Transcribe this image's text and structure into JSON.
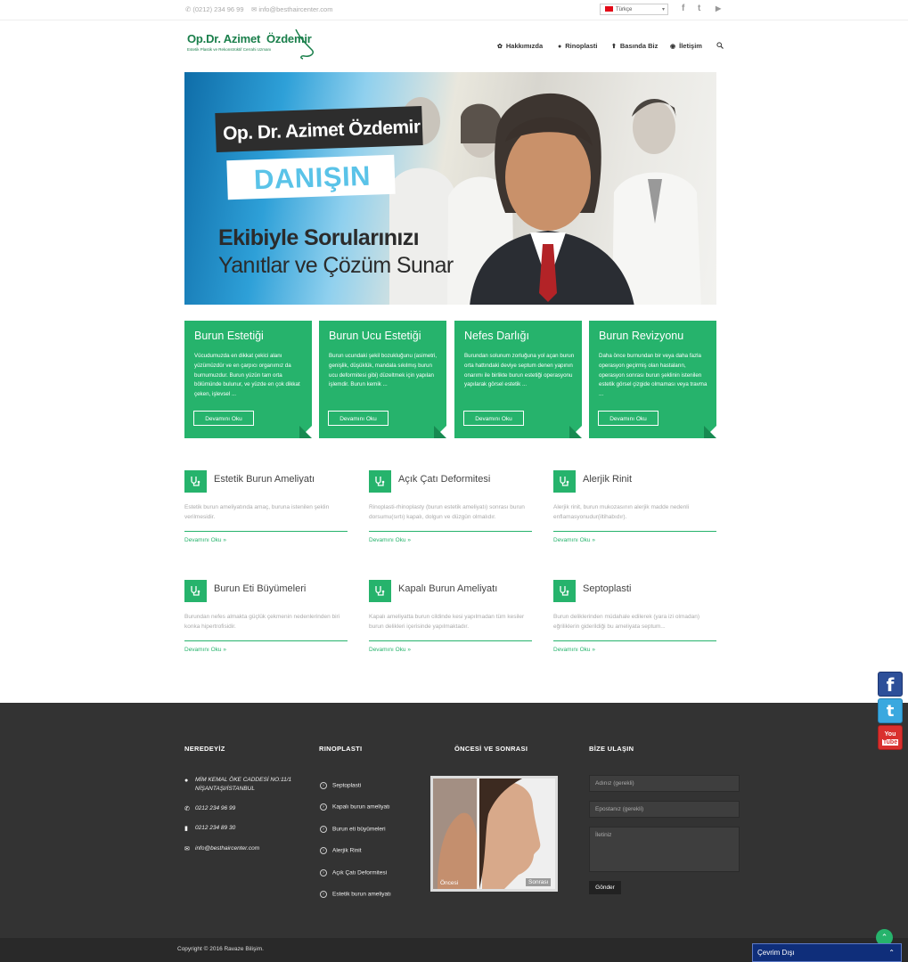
{
  "topbar": {
    "phone": "(0212) 234 96 99",
    "email": "info@besthaircenter.com",
    "language": "Türkçe",
    "social_icons": [
      "facebook-icon",
      "twitter-icon",
      "youtube-icon"
    ]
  },
  "logo": {
    "name_part1": "Op.Dr. Azimet",
    "name_part2": "Özdemir",
    "subtitle": "Estetik Plastik ve Rekonstrüktif Cerrahi Uzmanı"
  },
  "nav": {
    "items": [
      {
        "label": "Hakkımızda",
        "icon": "leaf-icon"
      },
      {
        "label": "Rinoplasti",
        "icon": "user-icon"
      },
      {
        "label": "Basında Biz",
        "icon": "pin-icon"
      },
      {
        "label": "İletişim",
        "icon": "wifi-icon"
      }
    ],
    "search_icon": "search-icon"
  },
  "hero": {
    "title": "Op. Dr. Azimet Özdemir",
    "highlight": "DANIŞIN",
    "line1": "Ekibiyle Sorularınızı",
    "line2": "Yanıtlar ve Çözüm Sunar"
  },
  "cards": [
    {
      "title": "Burun Estetiği",
      "text": "Vücudumuzda en dikkat çekici alanı yüzümüzdür ve en çarpıcı organımız da burnumuzdur.  Burun yüzün tam orta bölümünde bulunur, ve yüzde en çok dikkat çeken, işlevsel ...",
      "button": "Devamını Oku"
    },
    {
      "title": "Burun Ucu Estetiği",
      "text": "Burun ucundaki şekil bozukluğunu (asimetri, genişlik, düşüklük, mandala sıkılmış burun ucu deformitesi gibi) düzeltmek için yapılan işlemdir. Burun kemik ...",
      "button": "Devamını Oku"
    },
    {
      "title": "Nefes Darlığı",
      "text": "Burundan solunum zorluğuna yol açan burun orta hattındaki deviye septum denen yapının onarımı ile birlikte burun estetiği operasyonu yapılarak görsel estetik  ...",
      "button": "Devamını Oku"
    },
    {
      "title": "Burun Revizyonu",
      "text": "Daha önce burnundan bir veya daha fazla operasyon geçirmiş olan hastaların, operasyon sonrası burun şeklinin istenilen estetik görsel çizgide olmaması veya travma  ...",
      "button": "Devamını Oku"
    }
  ],
  "services": [
    {
      "title": "Estetik Burun Ameliyatı",
      "desc": "Estetik burun ameliyatında amaç, buruna istenilen şeklin verilmesidir.",
      "more": "Devamını Oku »"
    },
    {
      "title": "Açık Çatı Deformitesi",
      "desc": "Rinoplasti-rhinoplasty  (burun estetik ameliyatı) sonrası burun dorsumu(sırtı) kapalı, dolgun ve düzgün olmalıdır.",
      "more": "Devamını Oku »"
    },
    {
      "title": "Alerjik Rinit",
      "desc": "Alerjik rinit, burun mukozasının alerjik madde nedenli enflamasyonudur(iltihabıdır).",
      "more": "Devamını Oku »"
    },
    {
      "title": "Burun Eti Büyümeleri",
      "desc": "Burundan nefes almakta güçlük çekmenin nedenlerinden biri konka hipertrofisidir.",
      "more": "Devamını Oku »"
    },
    {
      "title": "Kapalı Burun Ameliyatı",
      "desc": "Kapalı ameliyatta burun cildinde kesi yapılmadan tüm kesiler burun delikleri içerisinde yapılmaktadır.",
      "more": "Devamını Oku »"
    },
    {
      "title": "Septoplasti",
      "desc": "Burun deliklerinden müdahale edilerek (yara izi olmadan) eğriliklerin giderildiği bu ameliyata septum...",
      "more": "Devamını Oku »"
    }
  ],
  "footer": {
    "col1_title": "NEREDEYİZ",
    "address_line1": "MİM KEMAL ÖKE CADDESİ NO:11/1",
    "address_line2": "NİŞANTAŞI/İSTANBUL",
    "phone": "0212 234 96 99",
    "fax": "0212 234 89 30",
    "email": "info@besthaircenter.com",
    "col2_title": "RINOPLASTI",
    "links": [
      "Septoplasti",
      "Kapalı burun ameliyatı",
      "Burun eti büyümeleri",
      "Alerjik Rinit",
      "Açık Çatı Deformitesi",
      "Estetik burun ameliyatı"
    ],
    "col3_title": "ÖNCESİ VE SONRASI",
    "before_label": "Öncesi",
    "after_label": "Sonrası",
    "col4_title": "BİZE ULAŞIN",
    "name_placeholder": "Adınız (gerekli)",
    "email_placeholder": "Epostanız (gerekli)",
    "message_placeholder": "İletiniz",
    "send_label": "Gönder",
    "copyright": "Copyright © 2016 Ravaze Bilişim."
  },
  "chat": {
    "label": "Çevrim Dışı"
  },
  "side_social": {
    "facebook": "f",
    "twitter": "t",
    "youtube_top": "You",
    "youtube_bottom": "Tube"
  },
  "colors": {
    "accent": "#26b36c",
    "footer_bg": "#333333",
    "chat_bg": "#0f2e7a"
  }
}
